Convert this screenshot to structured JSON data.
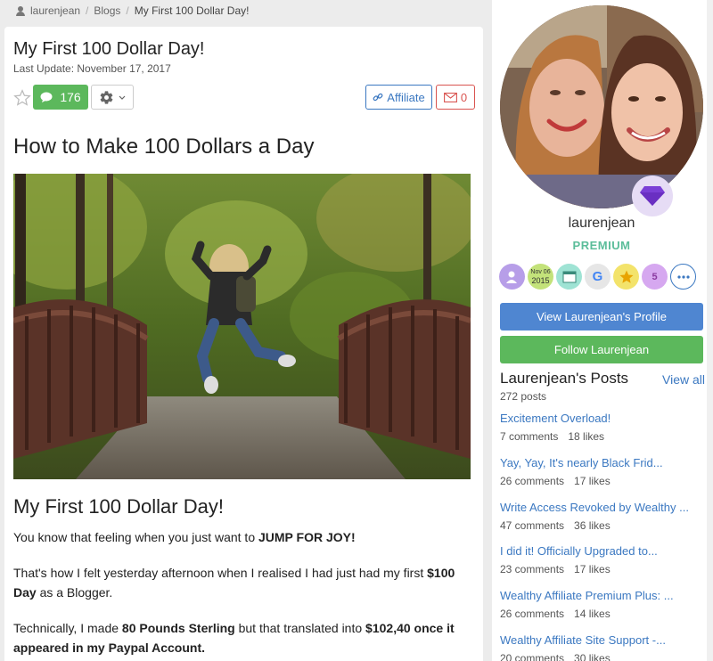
{
  "breadcrumb": {
    "user": "laurenjean",
    "section": "Blogs",
    "current": "My First 100 Dollar Day!"
  },
  "post": {
    "title": "My First 100 Dollar Day!",
    "last_update": "Last Update: November 17, 2017",
    "comment_count": "176",
    "affiliate_label": "Affiliate",
    "mail_count": "0",
    "heading": "How to Make 100 Dollars a Day",
    "subtitle": "My First 100 Dollar Day!",
    "p1_text": "You know that feeling when you just want to ",
    "p1_bold": "JUMP FOR JOY!",
    "p2_text": "That's how I felt yesterday afternoon when I realised I had just had my first ",
    "p2_bold": "$100 Day",
    "p2_tail": " as a Blogger.",
    "p3_text": "Technically, I made ",
    "p3_bold1": "80 Pounds Sterling",
    "p3_mid": " but that translated into ",
    "p3_bold2": "$102,40 once it appeared in my Paypal Account."
  },
  "sidebar": {
    "username": "laurenjean",
    "membership": "PREMIUM",
    "badge_date_month": "Nov 06",
    "badge_date_year": "2015",
    "badge_g": "G",
    "badge_five": "5",
    "view_profile_label": "View Laurenjean's Profile",
    "follow_label": "Follow Laurenjean",
    "posts_heading": "Laurenjean's Posts",
    "view_all": "View all",
    "posts_count": "272 posts",
    "posts": [
      {
        "title": "Excitement Overload!",
        "comments": "7 comments",
        "likes": "18 likes"
      },
      {
        "title": "Yay, Yay, It's nearly Black Frid...",
        "comments": "26 comments",
        "likes": "17 likes"
      },
      {
        "title": "Write Access Revoked by Wealthy ...",
        "comments": "47 comments",
        "likes": "36 likes"
      },
      {
        "title": "I did it! Officially Upgraded to...",
        "comments": "23 comments",
        "likes": "17 likes"
      },
      {
        "title": "Wealthy Affiliate Premium Plus: ...",
        "comments": "26 comments",
        "likes": "14 likes"
      },
      {
        "title": "Wealthy Affiliate Site Support -...",
        "comments": "20 comments",
        "likes": "30 likes"
      }
    ]
  },
  "colors": {
    "green": "#5cb85c",
    "blue": "#4f86d1",
    "link": "#3b78c1",
    "premium": "#5bbd9a",
    "premium_badge": "#7b3fd6"
  },
  "icons": [
    "user-icon",
    "star-icon",
    "comment-icon",
    "gear-icon",
    "chevron-down-icon",
    "link-icon",
    "mail-icon",
    "diamond-icon",
    "ellipsis-icon"
  ]
}
